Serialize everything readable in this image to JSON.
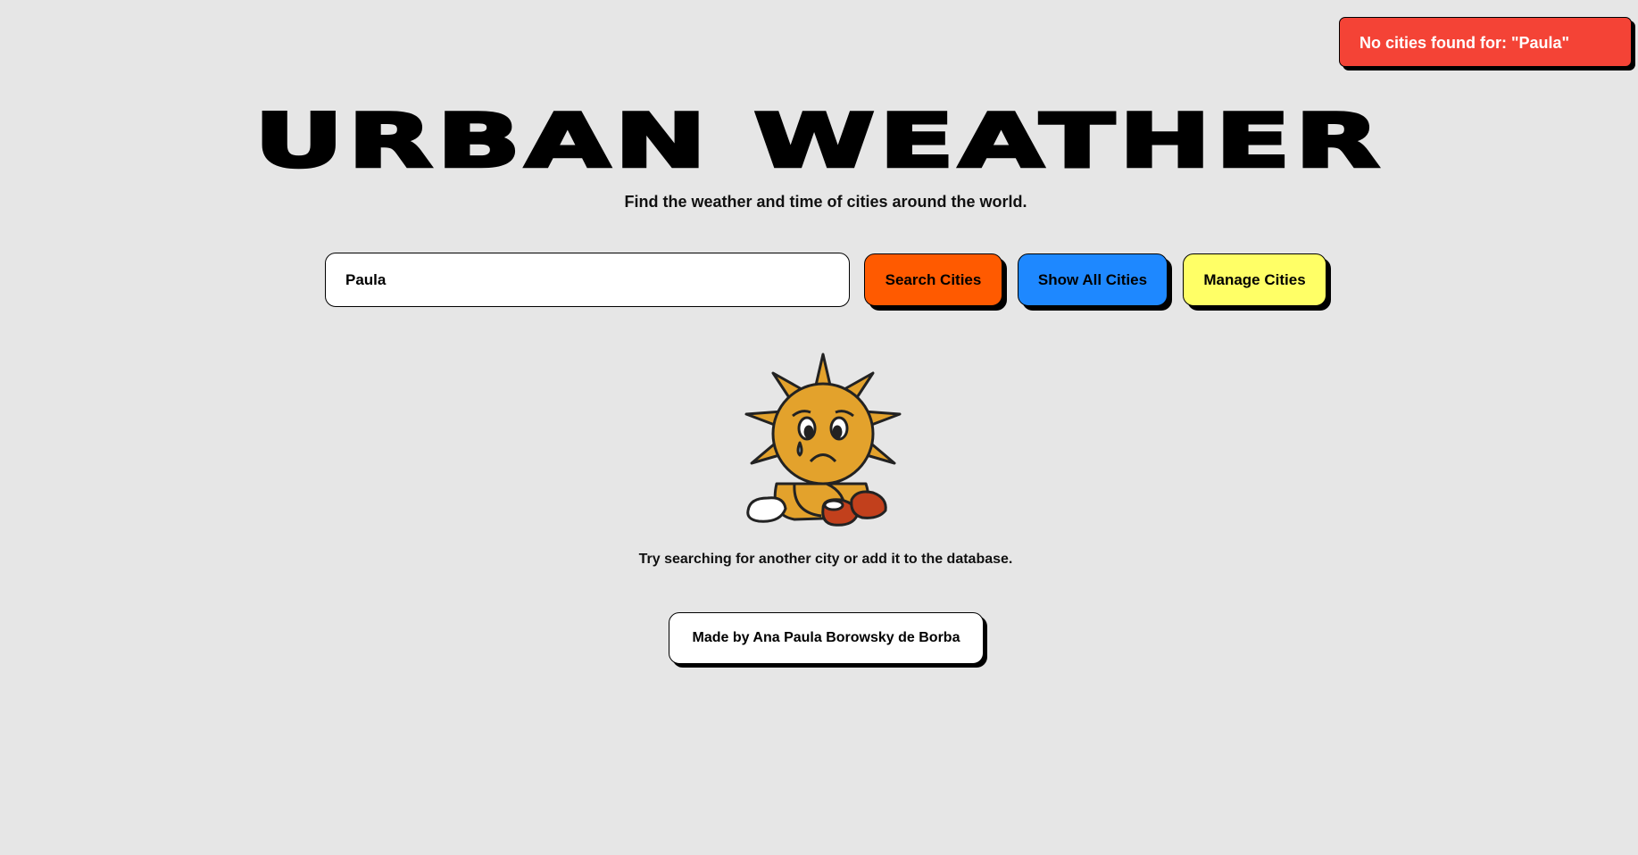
{
  "toast": {
    "message": "No cities found for: \"Paula\"",
    "color": "#f44336"
  },
  "header": {
    "title": "URBAN WEATHER",
    "subtitle": "Find the weather and time of cities around the world."
  },
  "search": {
    "value": "Paula",
    "search_button_label": "Search Cities",
    "show_all_label": "Show All Cities",
    "manage_label": "Manage Cities"
  },
  "empty_state": {
    "illustration": "sad-sun-illustration",
    "hint": "Try searching for another city or add it to the database."
  },
  "footer": {
    "credit": "Made by Ana Paula Borowsky de Borba"
  },
  "colors": {
    "background": "#e6e6e6",
    "search_button": "#ff5a00",
    "show_all_button": "#1e88ff",
    "manage_button": "#ffff66",
    "sun": "#e3a22c"
  }
}
